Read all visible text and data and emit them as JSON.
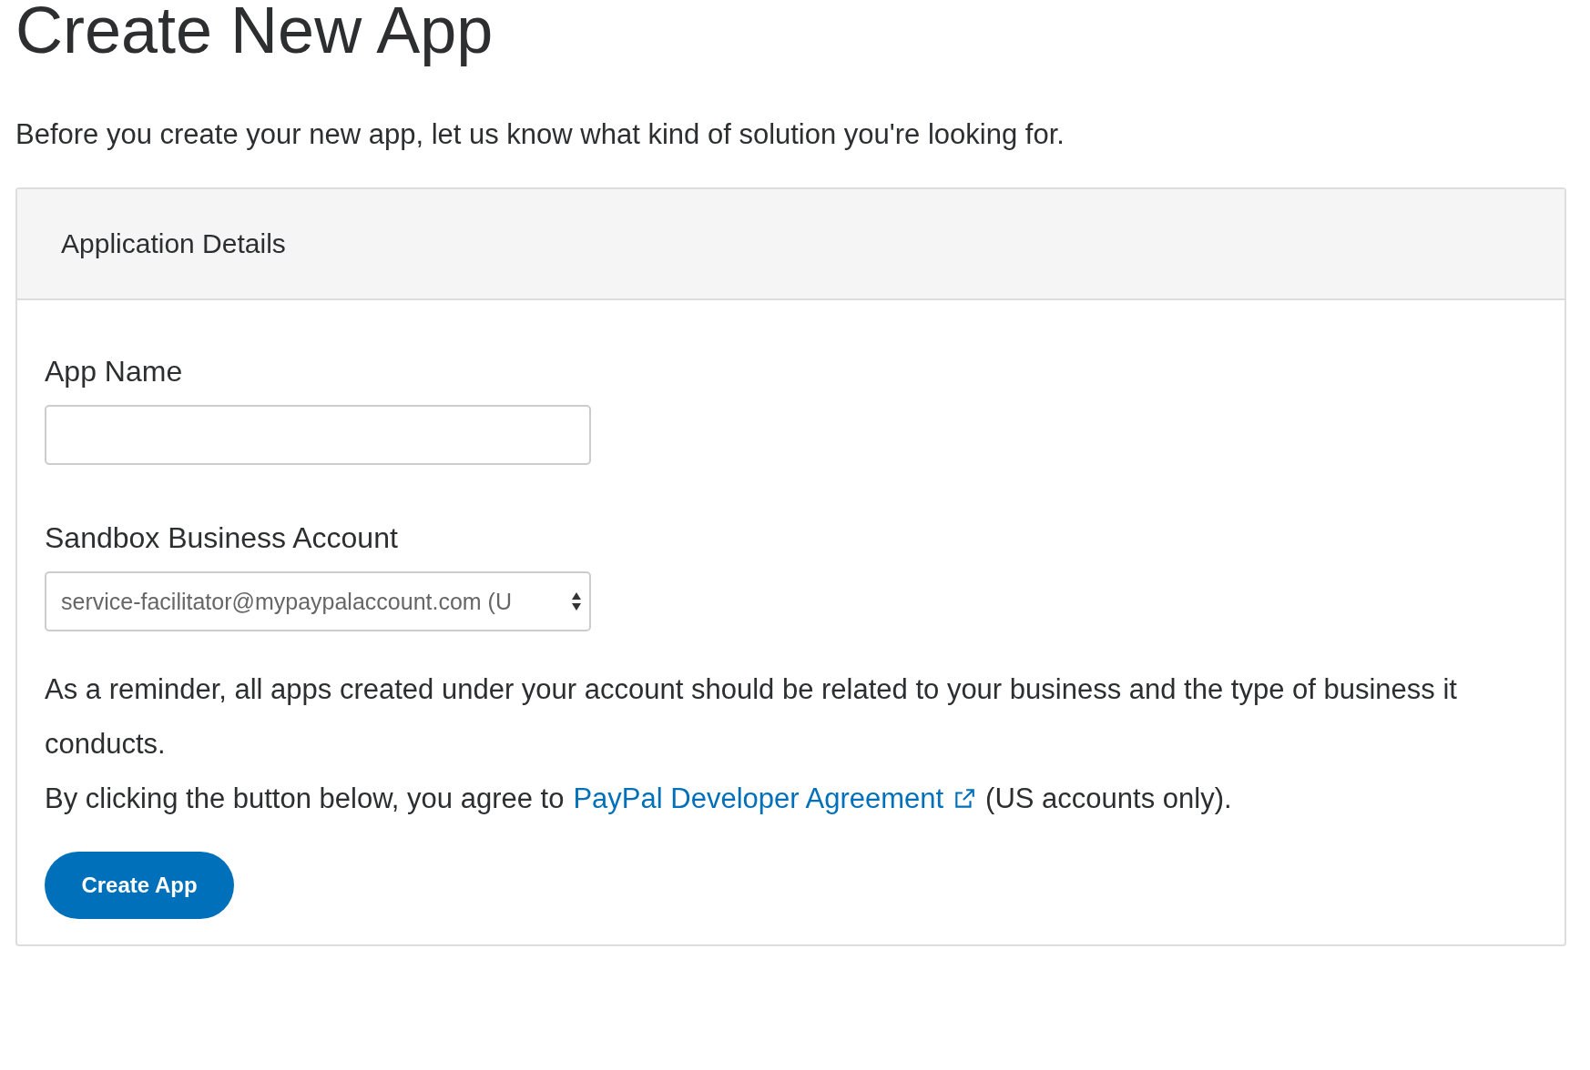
{
  "title": "Create New App",
  "intro": "Before you create your new app, let us know what kind of solution you're looking for.",
  "card": {
    "header": "Application Details",
    "fields": [
      {
        "kind": "text",
        "label": "App Name"
      },
      {
        "kind": "select",
        "label": "Sandbox Business Account",
        "value": "service-facilitator@mypaypalaccount.com (U"
      }
    ],
    "reminder": "As a reminder, all apps created under your account should be related to your business and the type of business it conducts.",
    "agreement": {
      "before": "By clicking the button below, you agree to",
      "link": "PayPal Developer Agreement",
      "after": "(US accounts only)."
    },
    "button": "Create App"
  }
}
